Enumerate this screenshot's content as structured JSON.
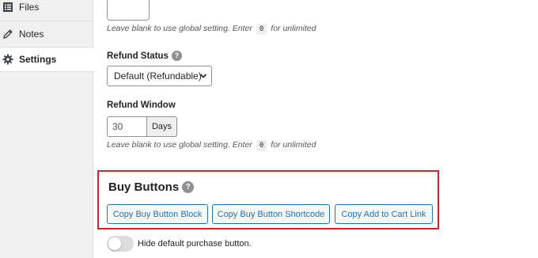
{
  "sidebar": {
    "items": [
      {
        "label": "Files",
        "icon": "files-icon",
        "active": false
      },
      {
        "label": "Notes",
        "icon": "pencil-icon",
        "active": false
      },
      {
        "label": "Settings",
        "icon": "gear-icon",
        "active": true
      }
    ]
  },
  "download_limit": {
    "value": "",
    "description_before": "Leave blank to use global setting. Enter",
    "code": "0",
    "description_after": "for unlimited"
  },
  "refund_status": {
    "label": "Refund Status",
    "selected": "Default (Refundable)"
  },
  "refund_window": {
    "label": "Refund Window",
    "value": "30",
    "addon": "Days",
    "description_before": "Leave blank to use global setting. Enter",
    "code": "0",
    "description_after": "for unlimited"
  },
  "buy_buttons": {
    "title": "Buy Buttons",
    "buttons": [
      {
        "label": "Copy Buy Button Block"
      },
      {
        "label": "Copy Buy Button Shortcode"
      },
      {
        "label": "Copy Add to Cart Link"
      }
    ],
    "highlight_color": "#e01e26"
  },
  "hide_purchase": {
    "label": "Hide default purchase button.",
    "enabled": false
  },
  "help_glyph": "?",
  "colors": {
    "accent": "#2271b1",
    "sidebar_bg": "#f0f0f1"
  }
}
